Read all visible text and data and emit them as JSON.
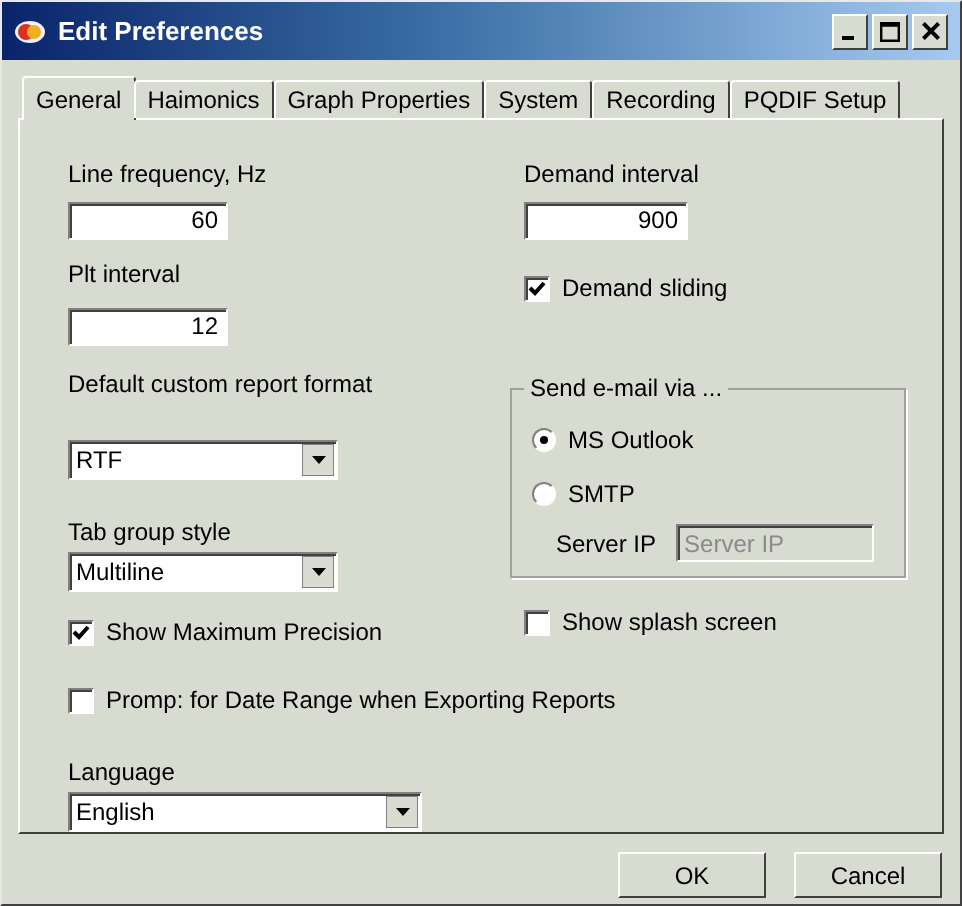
{
  "window": {
    "title": "Edit Preferences"
  },
  "tabs": [
    {
      "label": "General",
      "selected": true
    },
    {
      "label": "Haimonics",
      "selected": false
    },
    {
      "label": "Graph Properties",
      "selected": false
    },
    {
      "label": "System",
      "selected": false
    },
    {
      "label": "Recording",
      "selected": false
    },
    {
      "label": "PQDIF Setup",
      "selected": false
    }
  ],
  "line_frequency": {
    "label": "Line frequency, Hz",
    "value": "60"
  },
  "plt_interval": {
    "label": "Plt interval",
    "value": "12"
  },
  "default_report_format": {
    "label": "Default custom report format",
    "value": "RTF"
  },
  "tab_group_style": {
    "label": "Tab group style",
    "value": "Multiline"
  },
  "show_max_precision": {
    "label": "Show Maximum Precision",
    "checked": true
  },
  "prompt_date_range": {
    "label": "Promp: for Date Range when Exporting Reports",
    "checked": false
  },
  "language": {
    "label": "Language",
    "value": "English"
  },
  "demand_interval": {
    "label": "Demand interval",
    "value": "900"
  },
  "demand_sliding": {
    "label": "Demand sliding",
    "checked": true
  },
  "email_group": {
    "title": "Send e-mail via ...",
    "options": [
      {
        "label": "MS Outlook",
        "selected": true
      },
      {
        "label": "SMTP",
        "selected": false
      }
    ],
    "server_ip": {
      "label": "Server IP",
      "placeholder": "Server IP",
      "disabled": true
    }
  },
  "show_splash": {
    "label": "Show splash screen",
    "checked": false
  },
  "buttons": [
    "OK",
    "Cancel"
  ]
}
